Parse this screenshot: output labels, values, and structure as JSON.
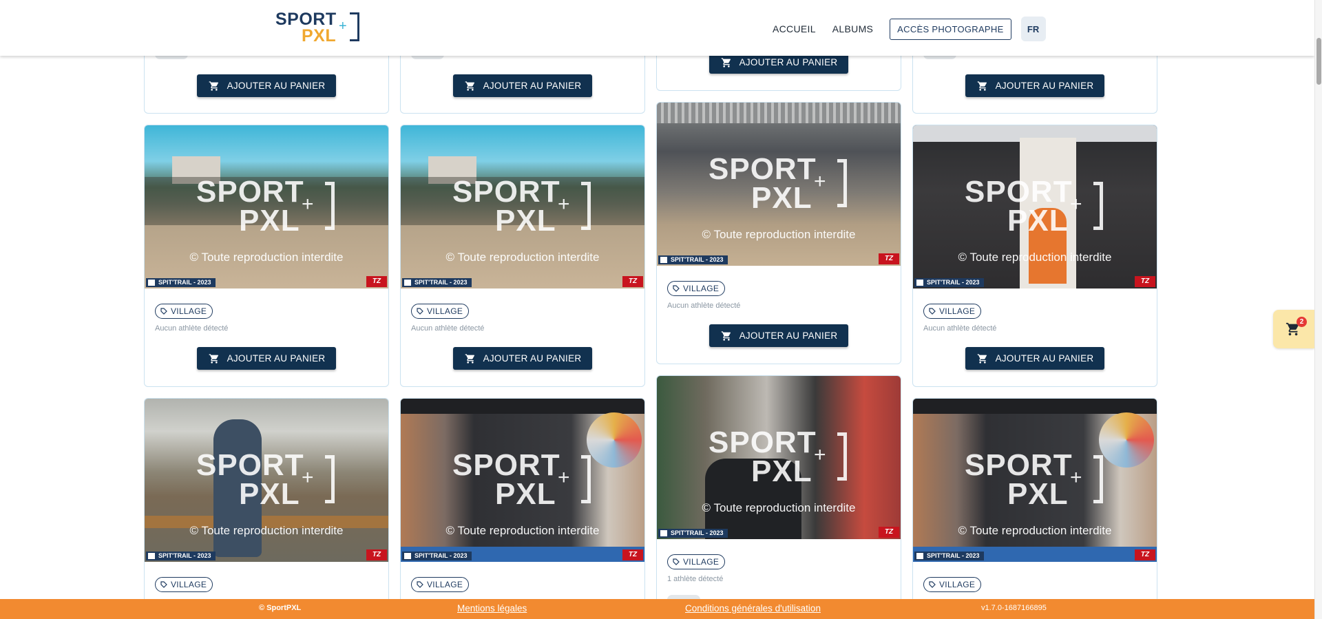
{
  "header": {
    "logo_line1": "SPORT",
    "logo_line2": "PXL",
    "logo_plus": "+",
    "nav": {
      "home": "ACCUEIL",
      "albums": "ALBUMS",
      "photographer": "ACCÈS PHOTOGRAPHE",
      "language": "FR"
    }
  },
  "common": {
    "add_to_cart": "AJOUTER AU PANIER",
    "tag": "VILLAGE",
    "watermark_line1": "SPORT",
    "watermark_line2": "PXL",
    "watermark_plus": "+",
    "watermark_copy": "© Toute reproduction interdite",
    "event_tag": "SPIT'TRAIL - 2023",
    "brand_corner": "TZ"
  },
  "photos": [
    {
      "detect": "Aucun athlète détecté",
      "scene": "field"
    },
    {
      "detect": "Aucun athlète détecté",
      "scene": "field"
    },
    {
      "detect": "Aucun athlète détecté",
      "scene": "market"
    },
    {
      "detect": "Aucun athlète détecté",
      "scene": "hall"
    },
    {
      "detect": "",
      "scene": "bench"
    },
    {
      "detect": "",
      "scene": "stage"
    },
    {
      "detect": "1 athlète détecté",
      "scene": "runners"
    },
    {
      "detect": "",
      "scene": "stage"
    }
  ],
  "cart": {
    "count": "2",
    "icon": "cart-icon"
  },
  "footer": {
    "copyright": "© SportPXL",
    "legal": "Mentions légales",
    "terms": "Conditions générales d'utilisation",
    "version": "v1.7.0-1687166895"
  },
  "colors": {
    "primary": "#11314f",
    "footer": "#f28a30",
    "cart_badge": "#e53935",
    "cart_bg": "#fbe7a9"
  }
}
